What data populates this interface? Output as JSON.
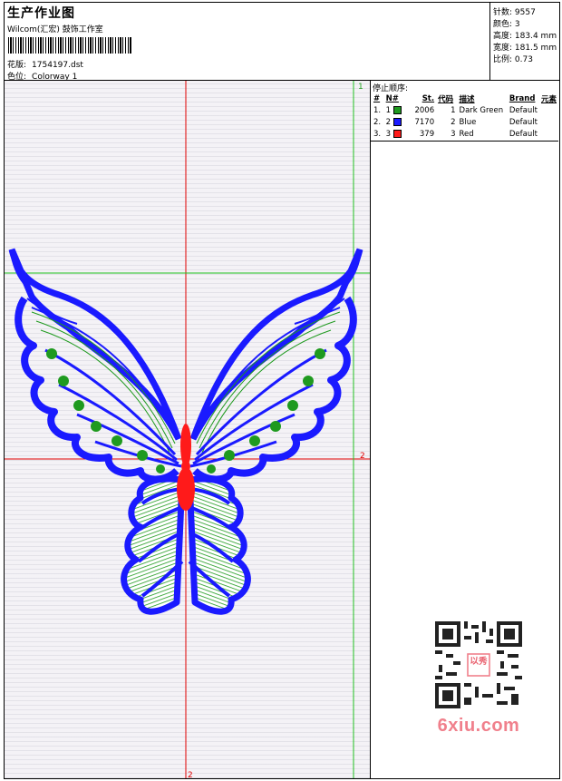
{
  "header": {
    "title": "生产作业图",
    "company": "Wilcom(汇宏) 鼓饰工作室",
    "design_label": "花版:",
    "design_value": "1754197.dst",
    "colorway_label": "色位:",
    "colorway_value": "Colorway 1"
  },
  "stats": [
    {
      "label": "针数:",
      "value": "9557"
    },
    {
      "label": "颜色:",
      "value": "3"
    },
    {
      "label": "高度:",
      "value": "183.4 mm"
    },
    {
      "label": "宽度:",
      "value": "181.5 mm"
    },
    {
      "label": "比例:",
      "value": "0.73"
    }
  ],
  "design": {
    "marker_top": "1",
    "marker_mid": "2",
    "marker_bottom": "2",
    "colors": {
      "blue": "#1a1aff",
      "green": "#1f9a1f",
      "red": "#ff1a1a",
      "guide_red": "#e00000",
      "guide_green": "#20c020"
    }
  },
  "stop_sequence": {
    "title": "停止顺序:",
    "columns": [
      "#",
      "N#",
      "St.",
      "代码",
      "描述",
      "Brand",
      "元素"
    ],
    "rows": [
      {
        "idx": "1.",
        "n": "1",
        "color": "#1f9a1f",
        "stitches": "2006",
        "code": "1",
        "desc": "Dark Green",
        "brand": "Default"
      },
      {
        "idx": "2.",
        "n": "2",
        "color": "#1a1aff",
        "stitches": "7170",
        "code": "2",
        "desc": "Blue",
        "brand": "Default"
      },
      {
        "idx": "3.",
        "n": "3",
        "color": "#ff1a1a",
        "stitches": "379",
        "code": "3",
        "desc": "Red",
        "brand": "Default"
      }
    ]
  },
  "watermark": {
    "logo_text": "以秀",
    "site_text": "6xiu.com"
  }
}
